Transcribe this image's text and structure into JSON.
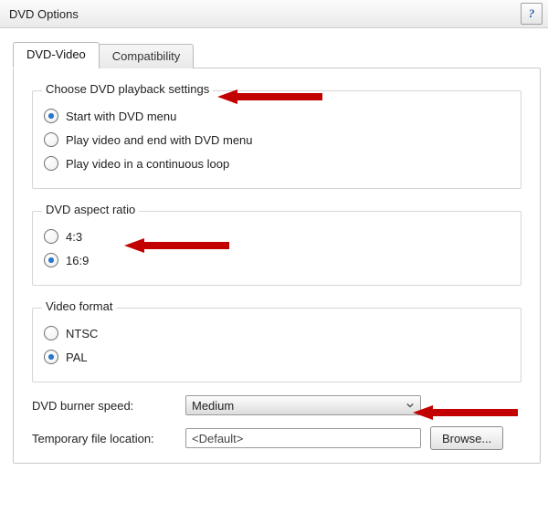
{
  "window": {
    "title": "DVD Options"
  },
  "tabs": {
    "dvd_video": "DVD-Video",
    "compatibility": "Compatibility"
  },
  "groups": {
    "playback": {
      "title": "Choose DVD playback settings",
      "options": {
        "start_menu": "Start with DVD menu",
        "play_end_menu": "Play video and end with DVD menu",
        "loop": "Play video in a continuous loop"
      }
    },
    "aspect": {
      "title": "DVD aspect ratio",
      "options": {
        "r43": "4:3",
        "r169": "16:9"
      }
    },
    "format": {
      "title": "Video format",
      "options": {
        "ntsc": "NTSC",
        "pal": "PAL"
      }
    }
  },
  "burner": {
    "label": "DVD burner speed:",
    "value": "Medium"
  },
  "temp": {
    "label": "Temporary file location:",
    "value": "<Default>",
    "browse": "Browse..."
  }
}
